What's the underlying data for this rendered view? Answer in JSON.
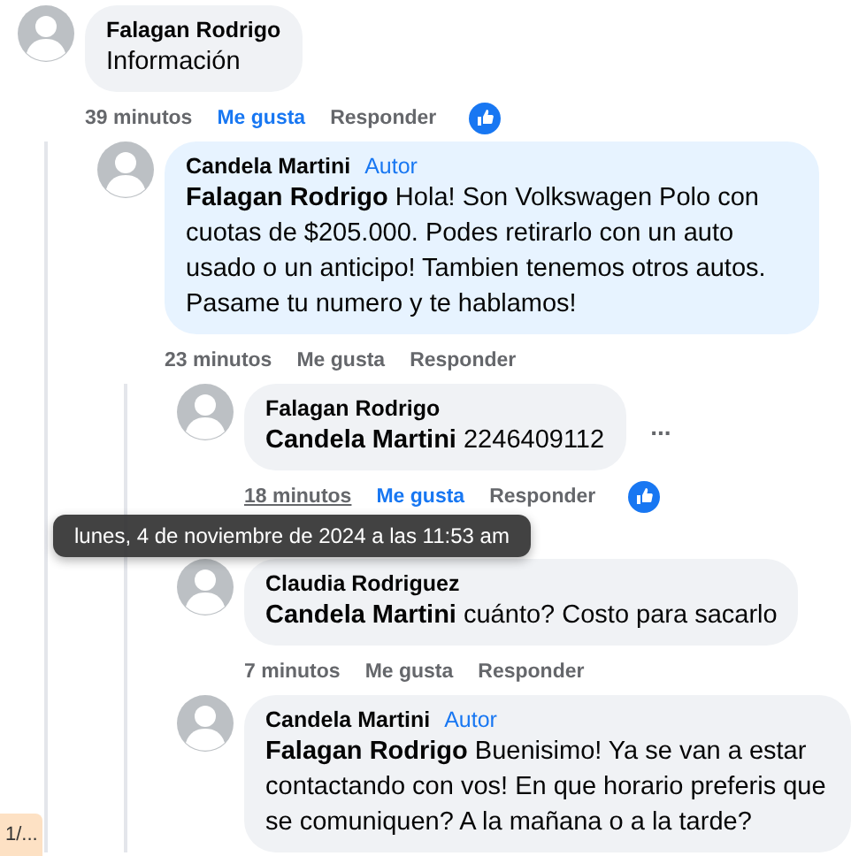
{
  "comments": [
    {
      "author": "Falagan Rodrigo",
      "text": "Información",
      "time": "39 minutos",
      "like_label": "Me gusta",
      "liked": true,
      "reply_label": "Responder",
      "reacted": true,
      "children": [
        {
          "author": "Candela Martini",
          "badge": "Autor",
          "highlighted": true,
          "mention": "Falagan Rodrigo",
          "text": "Hola! Son Volkswagen Polo con cuotas de $205.000. Podes retirarlo con un auto usado o un anticipo! Tambien tenemos otros autos. Pasame tu numero y te hablamos!",
          "time": "23 minutos",
          "like_label": "Me gusta",
          "liked": false,
          "reply_label": "Responder",
          "reacted": false,
          "children": [
            {
              "author": "Falagan Rodrigo",
              "mention": "Candela Martini",
              "text": "2246409112",
              "more": "...",
              "time": "18 minutos",
              "hovered": true,
              "like_label": "Me gusta",
              "liked": true,
              "reply_label": "Responder",
              "reacted": true
            },
            {
              "author": "Claudia Rodriguez",
              "mention": "Candela Martini",
              "text": "cuánto? Costo para sacarlo",
              "time": "7 minutos",
              "like_label": "Me gusta",
              "liked": false,
              "reply_label": "Responder",
              "reacted": false
            },
            {
              "author": "Candela Martini",
              "badge": "Autor",
              "mention": "Falagan Rodrigo",
              "text": "Buenisimo! Ya se van a estar contactando con vos! En que horario preferis que se comuniquen? A la mañana o a la tarde?"
            }
          ]
        }
      ]
    }
  ],
  "tooltip": "lunes, 4 de noviembre de 2024 a las 11:53 am",
  "page_indicator": "1/..."
}
